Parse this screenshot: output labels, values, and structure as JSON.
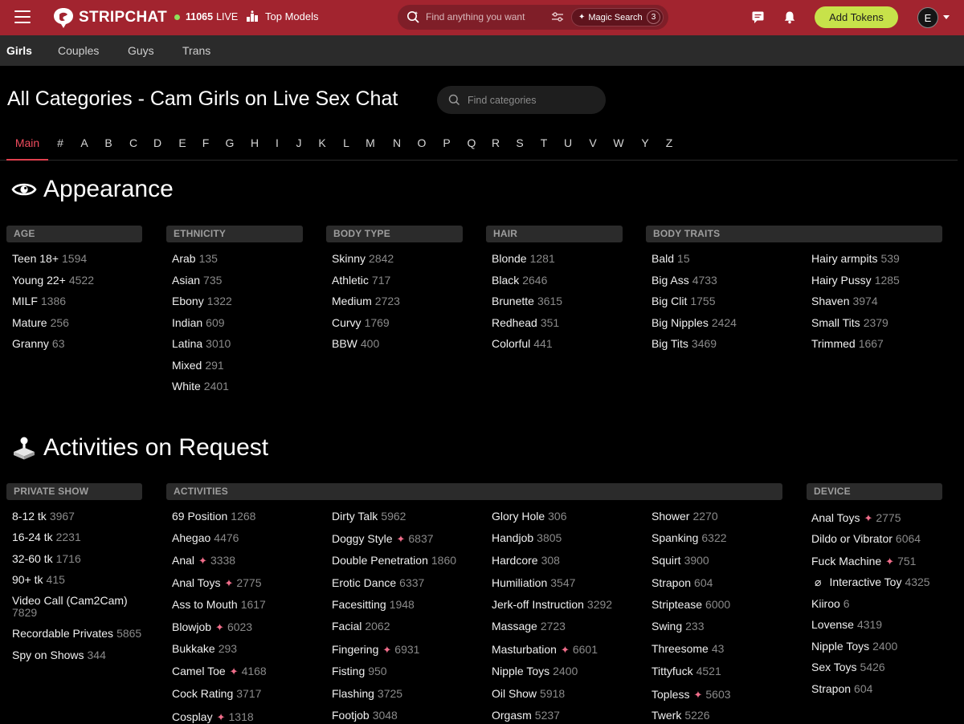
{
  "header": {
    "brand": "STRIPCHAT",
    "live_count": "11065",
    "live_label": "LIVE",
    "top_models": "Top Models",
    "search_placeholder": "Find anything you want",
    "magic_search": "Magic Search",
    "magic_count": "3",
    "add_tokens": "Add Tokens",
    "avatar_letter": "E"
  },
  "subnav": [
    "Girls",
    "Couples",
    "Guys",
    "Trans"
  ],
  "page": {
    "title": "All Categories - Cam Girls on Live Sex Chat",
    "category_search_placeholder": "Find categories"
  },
  "letters": [
    "Main",
    "#",
    "A",
    "B",
    "C",
    "D",
    "E",
    "F",
    "G",
    "H",
    "I",
    "J",
    "K",
    "L",
    "M",
    "N",
    "O",
    "P",
    "Q",
    "R",
    "S",
    "T",
    "U",
    "V",
    "W",
    "Y",
    "Z"
  ],
  "appearance": {
    "title": "Appearance",
    "age_head": "AGE",
    "ethnicity_head": "ETHNICITY",
    "bodytype_head": "BODY TYPE",
    "hair_head": "HAIR",
    "bodytraits_head": "BODY TRAITS",
    "age": [
      [
        "Teen 18+",
        "1594"
      ],
      [
        "Young 22+",
        "4522"
      ],
      [
        "MILF",
        "1386"
      ],
      [
        "Mature",
        "256"
      ],
      [
        "Granny",
        "63"
      ]
    ],
    "ethnicity": [
      [
        "Arab",
        "135"
      ],
      [
        "Asian",
        "735"
      ],
      [
        "Ebony",
        "1322"
      ],
      [
        "Indian",
        "609"
      ],
      [
        "Latina",
        "3010"
      ],
      [
        "Mixed",
        "291"
      ],
      [
        "White",
        "2401"
      ]
    ],
    "bodytype": [
      [
        "Skinny",
        "2842"
      ],
      [
        "Athletic",
        "717"
      ],
      [
        "Medium",
        "2723"
      ],
      [
        "Curvy",
        "1769"
      ],
      [
        "BBW",
        "400"
      ]
    ],
    "hair": [
      [
        "Blonde",
        "1281"
      ],
      [
        "Black",
        "2646"
      ],
      [
        "Brunette",
        "3615"
      ],
      [
        "Redhead",
        "351"
      ],
      [
        "Colorful",
        "441"
      ]
    ],
    "traits1": [
      [
        "Bald",
        "15"
      ],
      [
        "Big Ass",
        "4733"
      ],
      [
        "Big Clit",
        "1755"
      ],
      [
        "Big Nipples",
        "2424"
      ],
      [
        "Big Tits",
        "3469"
      ]
    ],
    "traits2": [
      [
        "Hairy armpits",
        "539"
      ],
      [
        "Hairy Pussy",
        "1285"
      ],
      [
        "Shaven",
        "3974"
      ],
      [
        "Small Tits",
        "2379"
      ],
      [
        "Trimmed",
        "1667"
      ]
    ]
  },
  "activities": {
    "title": "Activities on Request",
    "private_head": "PRIVATE SHOW",
    "activities_head": "ACTIVITIES",
    "device_head": "DEVICE",
    "private": [
      [
        "8-12 tk",
        "3967"
      ],
      [
        "16-24 tk",
        "2231"
      ],
      [
        "32-60 tk",
        "1716"
      ],
      [
        "90+ tk",
        "415"
      ],
      [
        "Video Call (Cam2Cam)",
        "7829"
      ],
      [
        "Recordable Privates",
        "5865"
      ],
      [
        "Spy on Shows",
        "344"
      ]
    ],
    "col1": [
      [
        "69 Position",
        "1268"
      ],
      [
        "Ahegao",
        "4476"
      ],
      [
        "Anal",
        "3338"
      ],
      [
        "Anal Toys",
        "2775"
      ],
      [
        "Ass to Mouth",
        "1617"
      ],
      [
        "Blowjob",
        "6023"
      ],
      [
        "Bukkake",
        "293"
      ],
      [
        "Camel Toe",
        "4168"
      ],
      [
        "Cock Rating",
        "3717"
      ],
      [
        "Cosplay",
        "1318"
      ]
    ],
    "col2": [
      [
        "Dirty Talk",
        "5962"
      ],
      [
        "Doggy Style",
        "6837"
      ],
      [
        "Double Penetration",
        "1860"
      ],
      [
        "Erotic Dance",
        "6337"
      ],
      [
        "Facesitting",
        "1948"
      ],
      [
        "Facial",
        "2062"
      ],
      [
        "Fingering",
        "6931"
      ],
      [
        "Fisting",
        "950"
      ],
      [
        "Flashing",
        "3725"
      ],
      [
        "Footjob",
        "3048"
      ]
    ],
    "col3": [
      [
        "Glory Hole",
        "306"
      ],
      [
        "Handjob",
        "3805"
      ],
      [
        "Hardcore",
        "308"
      ],
      [
        "Humiliation",
        "3547"
      ],
      [
        "Jerk-off Instruction",
        "3292"
      ],
      [
        "Massage",
        "2723"
      ],
      [
        "Masturbation",
        "6601"
      ],
      [
        "Nipple Toys",
        "2400"
      ],
      [
        "Oil Show",
        "5918"
      ],
      [
        "Orgasm",
        "5237"
      ]
    ],
    "col4": [
      [
        "Shower",
        "2270"
      ],
      [
        "Spanking",
        "6322"
      ],
      [
        "Squirt",
        "3900"
      ],
      [
        "Strapon",
        "604"
      ],
      [
        "Striptease",
        "6000"
      ],
      [
        "Swing",
        "233"
      ],
      [
        "Threesome",
        "43"
      ],
      [
        "Tittyfuck",
        "4521"
      ],
      [
        "Topless",
        "5603"
      ],
      [
        "Twerk",
        "5226"
      ]
    ],
    "device": [
      [
        "Anal Toys",
        "2775"
      ],
      [
        "Dildo or Vibrator",
        "6064"
      ],
      [
        "Fuck Machine",
        "751"
      ],
      [
        "Interactive Toy",
        "4325"
      ],
      [
        "Kiiroo",
        "6"
      ],
      [
        "Lovense",
        "4319"
      ],
      [
        "Nipple Toys",
        "2400"
      ],
      [
        "Sex Toys",
        "5426"
      ],
      [
        "Strapon",
        "604"
      ]
    ]
  },
  "colors": {
    "topbar": "#a2242f",
    "accent": "#f04c5e",
    "tokens": "#c7e24a",
    "sparkle": "#f06d8a"
  }
}
